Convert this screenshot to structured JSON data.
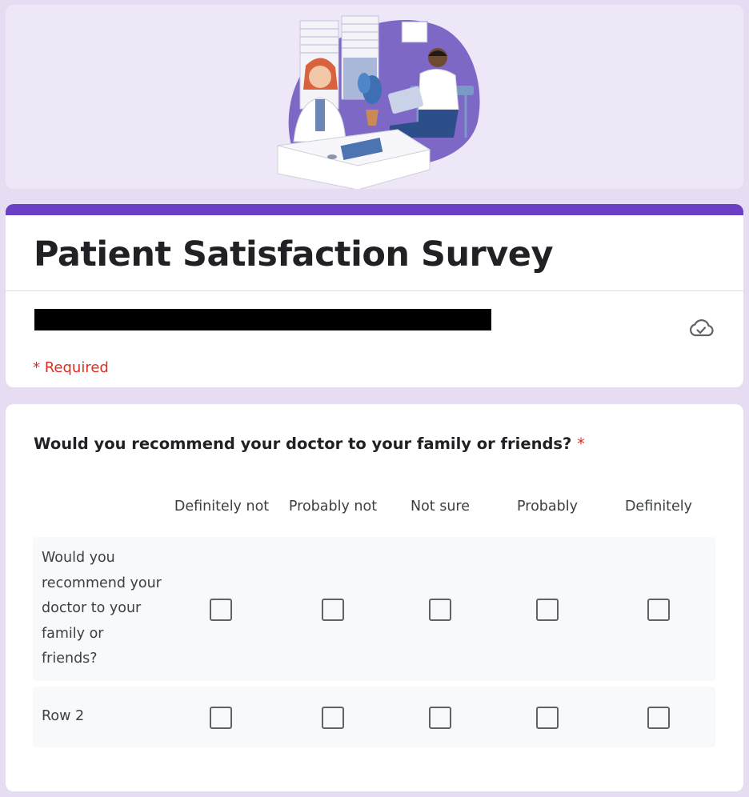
{
  "form": {
    "title": "Patient Satisfaction Survey",
    "required_note": "* Required"
  },
  "question": {
    "title": "Would you recommend your doctor to your family or friends?",
    "required_marker": "*",
    "columns": [
      "Definitely not",
      "Probably not",
      "Not sure",
      "Probably",
      "Definitely"
    ],
    "rows": [
      "Would you recommend your doctor to your family or friends?",
      "Row 2"
    ]
  },
  "icons": {
    "header_illustration": "clinic-illustration",
    "save_status": "cloud-saved-icon"
  },
  "colors": {
    "page_bg": "#e6ddf2",
    "banner_bg": "#ede7f7",
    "accent": "#6a3fc4",
    "required": "#d93025",
    "row_bg": "#f8f9fa"
  }
}
